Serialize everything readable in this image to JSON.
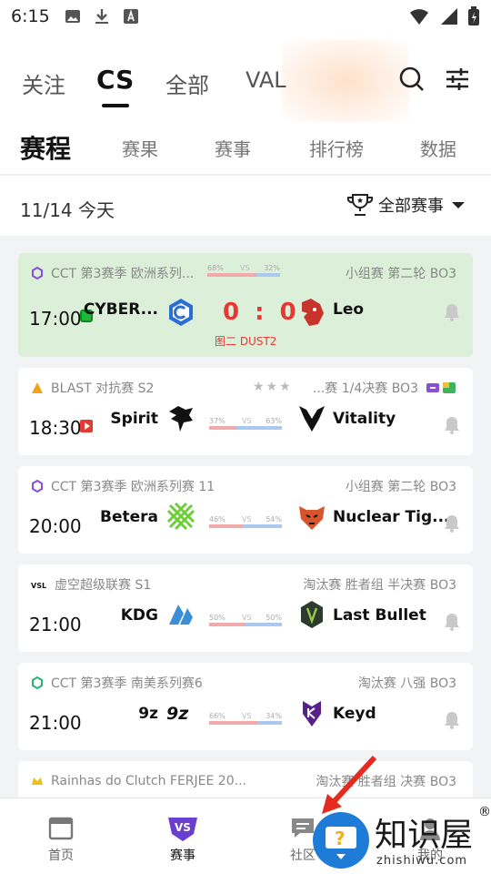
{
  "status_bar": {
    "time": "6:15"
  },
  "top_tabs": [
    "关注",
    "CS",
    "全部",
    "VAL"
  ],
  "sub_tabs": [
    "赛程",
    "赛果",
    "赛事",
    "排行榜",
    "数据"
  ],
  "date_line": {
    "date": "11/14  今天",
    "filter_label": "全部赛事"
  },
  "matches": [
    {
      "league": "CCT 第3赛季 欧洲系列...",
      "stage": "小组赛 第二轮 BO3",
      "time": "17:00",
      "team_left": "CYBER...",
      "team_right": "Leo",
      "odds_left": "68%",
      "odds_right": "32%",
      "vs": "VS",
      "score": "0 : 0",
      "map_info": "图二 DUST2",
      "live": true
    },
    {
      "league": "BLAST 对抗赛 S2",
      "stage": "...赛 1/4决赛  BO3",
      "time": "18:30",
      "team_left": "Spirit",
      "team_right": "Vitality",
      "odds_left": "37%",
      "odds_right": "63%",
      "vs": "VS",
      "stars": "★★★"
    },
    {
      "league": "CCT 第3赛季 欧洲系列赛 11",
      "stage": "小组赛 第二轮 BO3",
      "time": "20:00",
      "team_left": "Betera",
      "team_right": "Nuclear Tig...",
      "odds_left": "46%",
      "odds_right": "54%",
      "vs": "VS"
    },
    {
      "league": "虚空超级联赛 S1",
      "stage": "淘汰赛 胜者组 半决赛 BO3",
      "time": "21:00",
      "team_left": "KDG",
      "team_right": "Last Bullet",
      "odds_left": "50%",
      "odds_right": "50%",
      "vs": "VS"
    },
    {
      "league": "CCT 第3赛季 南美系列赛6",
      "stage": "淘汰赛 八强 BO3",
      "time": "21:00",
      "team_left": "9z",
      "team_right": "Keyd",
      "odds_left": "66%",
      "odds_right": "34%",
      "vs": "VS"
    },
    {
      "league": "Rainhas do Clutch FERJEE 20...",
      "stage": "淘汰赛 胜者组 决赛 BO3"
    }
  ],
  "bottom_nav": [
    "首页",
    "赛事",
    "社区",
    "我的"
  ],
  "watermark": {
    "text": "知识屋",
    "sub": "zhishiwu.com",
    "reg": "®"
  }
}
